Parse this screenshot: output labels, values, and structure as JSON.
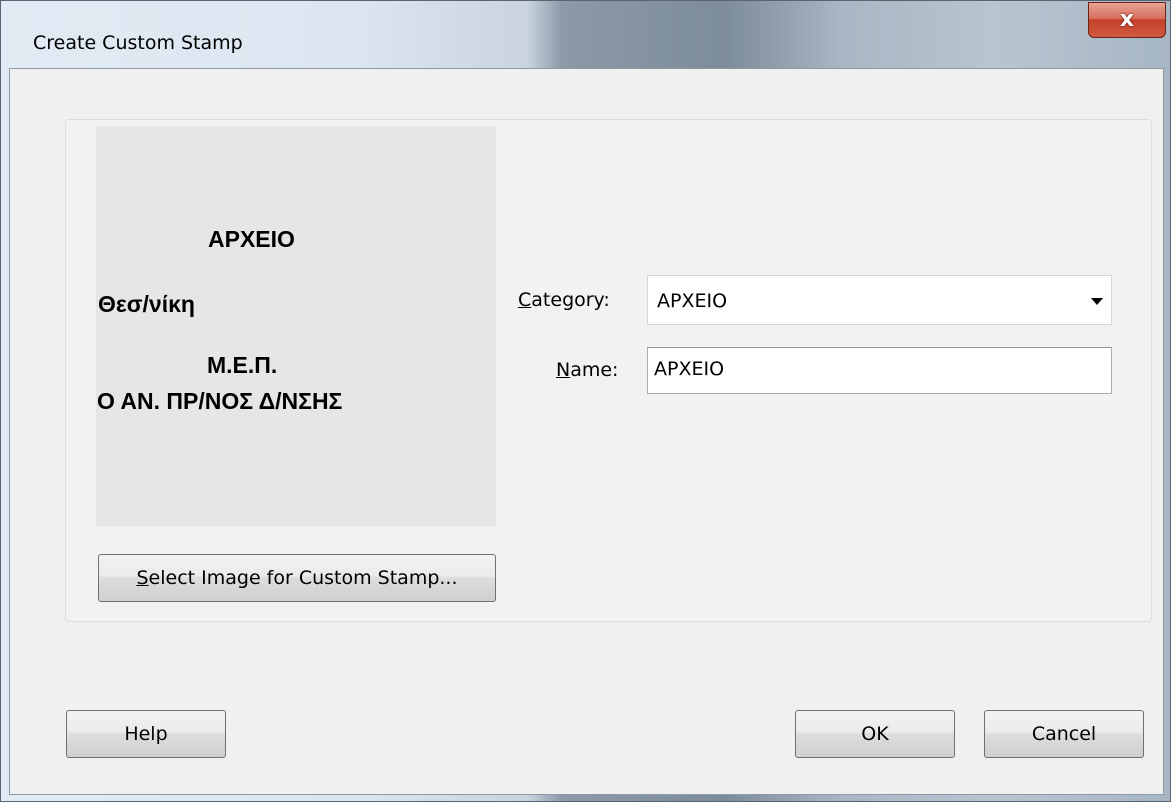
{
  "window": {
    "title": "Create Custom Stamp",
    "close_glyph": "x"
  },
  "stamp_preview": {
    "lines": [
      "ΑΡΧΕΙΟ",
      "Θεσ/νίκη",
      "Μ.Ε.Π.",
      "Ο ΑΝ. ΠΡ/ΝΟΣ Δ/ΝΣΗΣ"
    ]
  },
  "select_image_button": {
    "accel": "S",
    "rest": "elect Image for Custom Stamp..."
  },
  "category": {
    "label_accel": "C",
    "label_rest": "ategory:",
    "value": "ΑΡΧΕΙΟ"
  },
  "name": {
    "label_accel": "N",
    "label_rest": "ame:",
    "value": "ΑΡΧΕΙΟ"
  },
  "buttons": {
    "help": "Help",
    "ok": "OK",
    "cancel": "Cancel"
  }
}
